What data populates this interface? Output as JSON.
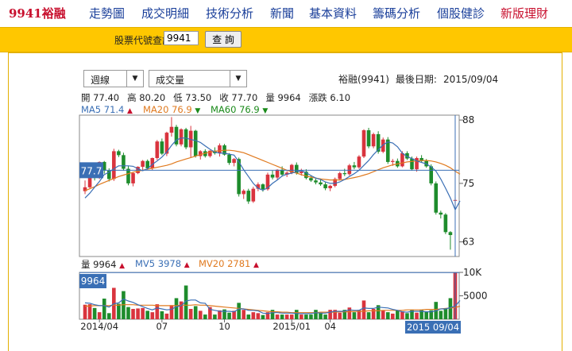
{
  "nav": {
    "brand": "9941裕融",
    "items": [
      "走勢圖",
      "成交明細",
      "技術分析",
      "新聞",
      "基本資料",
      "籌碼分析",
      "個股健診",
      "新版理財"
    ]
  },
  "search": {
    "label": "股票代號查詢",
    "value": "9941",
    "button": "查 詢"
  },
  "controls": {
    "period": "週線",
    "indicator": "成交量"
  },
  "stock": {
    "name": "裕融(9941)",
    "last_date_label": "最後日期:",
    "last_date": "2015/09/04"
  },
  "ohlc": {
    "open": "開 77.40",
    "high": "高 80.20",
    "low": "低 73.50",
    "close": "收 77.70",
    "volume": "量 9964",
    "change": "漲跌 6.10"
  },
  "ma": {
    "ma5": {
      "label": "MA5 71.4",
      "trend": "up",
      "color": "#3a6fb5"
    },
    "ma20": {
      "label": "MA20 76.9",
      "trend": "down",
      "color": "#e07a1f"
    },
    "ma60": {
      "label": "MA60 76.9",
      "trend": "down",
      "color": "#1a8a1a"
    }
  },
  "vol_info": {
    "vol": {
      "label": "量 9964",
      "trend": "up",
      "color": "#222"
    },
    "mv5": {
      "label": "MV5 3978",
      "trend": "up",
      "color": "#3a6fb5"
    },
    "mv20": {
      "label": "MV20 2781",
      "trend": "up",
      "color": "#e07a1f"
    }
  },
  "colors": {
    "up": "#d9343e",
    "down": "#1e8c2c",
    "ma5": "#3a6fb5",
    "ma20": "#e07a1f",
    "crosshair": "#3a6fb5"
  },
  "chart_data": {
    "type": "bar",
    "price_axis": {
      "ticks": [
        88,
        75,
        63
      ],
      "ylim": [
        60,
        89
      ]
    },
    "volume_axis": {
      "ticks": [
        "10K",
        "5000"
      ],
      "ylim": [
        0,
        10000
      ]
    },
    "x_ticks": [
      "2014/04",
      "07",
      "10",
      "2015/01",
      "04",
      "2015 09/04"
    ],
    "crosshair": {
      "price_label": "77.7",
      "volume_label": "9964",
      "date_label": "2015 09/04"
    },
    "weeks": [
      [
        73.4,
        75.6,
        72.8,
        74.2,
        3100
      ],
      [
        74.2,
        77.6,
        74.0,
        77.4,
        3200
      ],
      [
        77.4,
        78.0,
        75.6,
        76.2,
        2400
      ],
      [
        76.2,
        79.5,
        75.9,
        79.4,
        1500
      ],
      [
        79.4,
        79.6,
        77.0,
        77.6,
        4400
      ],
      [
        77.6,
        78.1,
        75.4,
        75.9,
        1300
      ],
      [
        75.9,
        82.1,
        75.5,
        81.6,
        6700
      ],
      [
        81.6,
        81.9,
        80.4,
        80.8,
        3300
      ],
      [
        80.8,
        81.3,
        77.6,
        78.0,
        6000
      ],
      [
        78.0,
        78.6,
        74.6,
        75.0,
        2600
      ],
      [
        75.0,
        77.3,
        74.4,
        77.1,
        2200
      ],
      [
        77.1,
        78.5,
        76.9,
        78.4,
        2300
      ],
      [
        78.4,
        79.8,
        77.6,
        79.6,
        2400
      ],
      [
        79.6,
        79.9,
        77.8,
        78.1,
        1800
      ],
      [
        78.1,
        80.3,
        77.7,
        80.2,
        1500
      ],
      [
        80.2,
        83.9,
        79.8,
        83.6,
        3200
      ],
      [
        83.6,
        84.2,
        80.8,
        81.1,
        1700
      ],
      [
        81.1,
        85.6,
        80.6,
        85.4,
        1200
      ],
      [
        85.4,
        88.6,
        84.6,
        86.6,
        3000
      ],
      [
        86.6,
        87.0,
        82.6,
        83.0,
        4500
      ],
      [
        83.0,
        86.3,
        82.6,
        86.1,
        3800
      ],
      [
        86.1,
        86.4,
        82.0,
        82.4,
        7200
      ],
      [
        82.4,
        86.8,
        80.2,
        85.8,
        2200
      ],
      [
        85.8,
        86.0,
        80.3,
        80.6,
        2800
      ],
      [
        80.6,
        81.8,
        79.9,
        81.6,
        1800
      ],
      [
        81.6,
        82.0,
        80.3,
        80.6,
        1000
      ],
      [
        80.6,
        81.8,
        80.3,
        81.7,
        2600
      ],
      [
        81.7,
        82.4,
        80.9,
        81.2,
        1000
      ],
      [
        81.2,
        83.2,
        80.5,
        82.8,
        1900
      ],
      [
        82.8,
        83.1,
        80.7,
        80.9,
        2100
      ],
      [
        80.9,
        81.2,
        78.8,
        79.2,
        1400
      ],
      [
        79.2,
        80.2,
        78.5,
        80.0,
        1800
      ],
      [
        80.0,
        80.3,
        72.3,
        72.8,
        3500
      ],
      [
        72.8,
        73.8,
        71.8,
        73.5,
        2000
      ],
      [
        73.5,
        73.9,
        70.8,
        71.3,
        1000
      ],
      [
        71.3,
        74.3,
        71.0,
        73.9,
        1500
      ],
      [
        73.9,
        75.2,
        73.4,
        74.8,
        1300
      ],
      [
        74.8,
        75.0,
        73.3,
        73.8,
        900
      ],
      [
        73.8,
        77.2,
        73.5,
        76.8,
        1500
      ],
      [
        76.8,
        77.6,
        75.8,
        76.2,
        2000
      ],
      [
        76.2,
        77.9,
        75.7,
        77.8,
        1000
      ],
      [
        77.8,
        78.5,
        76.4,
        76.8,
        1000
      ],
      [
        76.8,
        77.5,
        76.3,
        77.2,
        1000
      ],
      [
        77.2,
        79.0,
        76.9,
        78.8,
        1000
      ],
      [
        78.8,
        79.3,
        76.8,
        77.1,
        2000
      ],
      [
        77.1,
        78.0,
        76.6,
        77.4,
        1000
      ],
      [
        77.4,
        77.9,
        75.8,
        76.1,
        1000
      ],
      [
        76.1,
        76.7,
        75.3,
        75.6,
        1000
      ],
      [
        75.6,
        76.0,
        74.8,
        75.2,
        2000
      ],
      [
        75.2,
        76.0,
        74.5,
        74.8,
        1400
      ],
      [
        74.8,
        75.2,
        73.6,
        74.0,
        1000
      ],
      [
        74.0,
        74.7,
        73.4,
        74.5,
        2000
      ],
      [
        74.5,
        76.2,
        74.2,
        75.9,
        2000
      ],
      [
        75.9,
        77.4,
        75.6,
        77.1,
        1400
      ],
      [
        77.1,
        78.0,
        76.5,
        76.9,
        2000
      ],
      [
        76.9,
        79.0,
        76.6,
        78.7,
        2500
      ],
      [
        78.7,
        79.4,
        77.9,
        78.3,
        1500
      ],
      [
        78.3,
        80.8,
        78.0,
        80.5,
        2000
      ],
      [
        80.5,
        86.1,
        80.2,
        85.9,
        4000
      ],
      [
        85.9,
        86.4,
        82.2,
        82.6,
        1500
      ],
      [
        82.6,
        85.4,
        82.2,
        85.1,
        2200
      ],
      [
        85.1,
        85.7,
        81.1,
        81.5,
        3000
      ],
      [
        81.5,
        84.4,
        81.2,
        84.0,
        1900
      ],
      [
        84.0,
        84.5,
        79.0,
        79.4,
        1500
      ],
      [
        79.4,
        80.0,
        78.6,
        79.6,
        1200
      ],
      [
        79.6,
        80.1,
        78.2,
        78.5,
        1900
      ],
      [
        78.5,
        81.6,
        78.3,
        81.2,
        1700
      ],
      [
        81.2,
        81.6,
        79.8,
        80.1,
        1300
      ],
      [
        80.1,
        80.5,
        77.6,
        77.9,
        2000
      ],
      [
        77.9,
        80.5,
        77.4,
        80.2,
        1400
      ],
      [
        80.2,
        80.8,
        79.3,
        79.6,
        2000
      ],
      [
        79.6,
        80.0,
        78.2,
        78.5,
        1600
      ],
      [
        78.5,
        78.9,
        74.6,
        75.0,
        1900
      ],
      [
        75.0,
        75.4,
        68.6,
        69.0,
        3700
      ],
      [
        69.0,
        69.4,
        67.8,
        68.6,
        1800
      ],
      [
        68.6,
        68.9,
        64.6,
        65.0,
        2200
      ],
      [
        65.0,
        65.2,
        61.4,
        64.4,
        4500
      ],
      [
        71.6,
        72.1,
        70.4,
        71.6,
        9964
      ]
    ],
    "ma5": [
      72.0,
      73.0,
      74.2,
      75.4,
      76.8,
      77.3,
      78.0,
      78.6,
      78.6,
      78.6,
      78.5,
      78.0,
      77.6,
      78.0,
      78.9,
      79.6,
      80.4,
      81.4,
      82.8,
      83.9,
      84.3,
      84.3,
      84.0,
      83.8,
      83.4,
      82.7,
      82.0,
      81.4,
      81.2,
      81.2,
      81.0,
      80.8,
      79.4,
      77.8,
      76.4,
      75.0,
      74.0,
      73.6,
      74.1,
      75.0,
      75.7,
      76.5,
      76.9,
      77.1,
      77.4,
      77.6,
      77.2,
      76.6,
      76.1,
      75.8,
      75.3,
      75.0,
      75.0,
      75.3,
      75.8,
      76.4,
      77.0,
      77.7,
      78.7,
      79.7,
      80.9,
      81.9,
      82.9,
      83.5,
      83.3,
      82.5,
      81.2,
      80.5,
      80.1,
      79.6,
      79.3,
      79.0,
      78.4,
      77.5,
      75.9,
      74.0,
      72.0,
      69.6,
      71.4
    ],
    "ma20": [
      73.5,
      73.9,
      74.3,
      74.8,
      75.2,
      75.6,
      76.0,
      76.4,
      76.7,
      77.0,
      77.3,
      77.5,
      77.7,
      77.9,
      78.1,
      78.3,
      78.5,
      78.7,
      79.0,
      79.4,
      79.7,
      80.0,
      80.3,
      80.6,
      80.9,
      81.2,
      81.4,
      81.6,
      81.7,
      81.8,
      81.8,
      81.7,
      81.5,
      81.3,
      80.9,
      80.5,
      80.1,
      79.7,
      79.3,
      78.9,
      78.5,
      78.1,
      77.7,
      77.4,
      77.1,
      76.8,
      76.5,
      76.3,
      76.1,
      75.9,
      75.8,
      75.7,
      75.7,
      75.7,
      75.8,
      76.0,
      76.2,
      76.4,
      76.7,
      77.0,
      77.4,
      77.8,
      78.2,
      78.5,
      78.8,
      79.0,
      79.2,
      79.4,
      79.5,
      79.6,
      79.7,
      79.7,
      79.6,
      79.4,
      79.1,
      78.7,
      78.2,
      77.5,
      76.9
    ],
    "mv5": [
      3500,
      3400,
      3100,
      2900,
      2900,
      2600,
      3300,
      3500,
      4300,
      3900,
      3600,
      3100,
      2700,
      2300,
      2000,
      2400,
      2200,
      2000,
      2100,
      2700,
      2900,
      3900,
      4100,
      4100,
      3500,
      3400,
      2100,
      1900,
      1700,
      1700,
      1700,
      1600,
      2200,
      2200,
      1900,
      1900,
      1800,
      1300,
      1200,
      1400,
      1400,
      1300,
      1300,
      1300,
      1200,
      1200,
      1200,
      1200,
      1400,
      1300,
      1300,
      1500,
      1700,
      1700,
      1700,
      2000,
      1900,
      1900,
      2400,
      2300,
      2300,
      2600,
      2500,
      2400,
      2100,
      1900,
      1600,
      1500,
      1700,
      1700,
      1700,
      1600,
      1600,
      1800,
      2200,
      2200,
      2500,
      2800,
      3978
    ],
    "mv20": [
      2800,
      2800,
      2900,
      2900,
      2900,
      2900,
      3000,
      3000,
      3100,
      3100,
      3100,
      3000,
      3000,
      3000,
      3000,
      2900,
      2900,
      2900,
      2900,
      2900,
      3000,
      3000,
      3000,
      3100,
      3000,
      3000,
      2900,
      2800,
      2700,
      2600,
      2500,
      2400,
      2300,
      2200,
      2100,
      2000,
      1900,
      1800,
      1700,
      1600,
      1600,
      1500,
      1500,
      1400,
      1400,
      1400,
      1400,
      1400,
      1400,
      1500,
      1500,
      1500,
      1500,
      1600,
      1600,
      1600,
      1700,
      1700,
      1700,
      1800,
      1800,
      1800,
      1900,
      1900,
      1900,
      1900,
      1900,
      2000,
      2000,
      2000,
      2000,
      2100,
      2100,
      2100,
      2200,
      2300,
      2400,
      2500,
      2781
    ]
  }
}
